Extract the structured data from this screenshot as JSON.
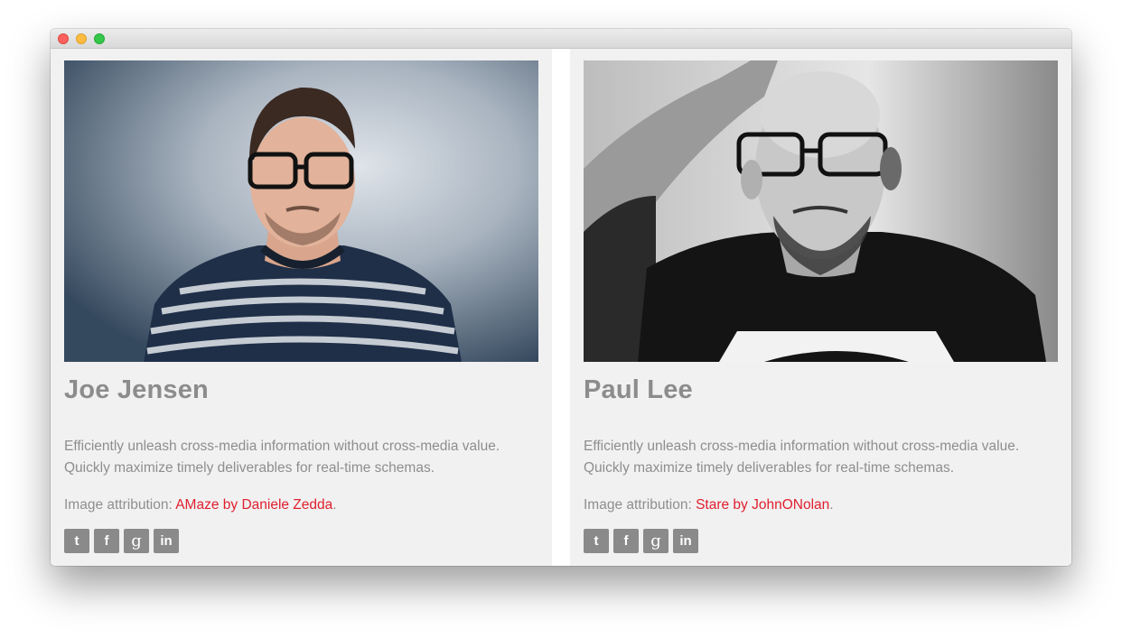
{
  "window": {
    "controls": [
      "close",
      "minimize",
      "maximize"
    ]
  },
  "cards": [
    {
      "name": "Joe Jensen",
      "description": "Efficiently unleash cross-media information without cross-media value. Quickly maximize timely deliverables for real-time schemas.",
      "attribution_prefix": "Image attribution: ",
      "attribution_link": "AMaze by Daniele Zedda",
      "attribution_suffix": ".",
      "social": [
        {
          "icon": "twitter-icon",
          "glyph": "t"
        },
        {
          "icon": "facebook-icon",
          "glyph": "f"
        },
        {
          "icon": "google-plus-icon",
          "glyph": "g"
        },
        {
          "icon": "linkedin-icon",
          "glyph": "in"
        }
      ]
    },
    {
      "name": "Paul Lee",
      "description": "Efficiently unleash cross-media information without cross-media value. Quickly maximize timely deliverables for real-time schemas.",
      "attribution_prefix": "Image attribution: ",
      "attribution_link": "Stare by JohnONolan",
      "attribution_suffix": ".",
      "social": [
        {
          "icon": "twitter-icon",
          "glyph": "t"
        },
        {
          "icon": "facebook-icon",
          "glyph": "f"
        },
        {
          "icon": "google-plus-icon",
          "glyph": "g"
        },
        {
          "icon": "linkedin-icon",
          "glyph": "in"
        }
      ]
    }
  ],
  "colors": {
    "card_bg": "#f1f1f2",
    "heading": "#8c8c8c",
    "text": "#8e8e8e",
    "link": "#e0202e",
    "social_bg": "#8a8a8a"
  }
}
